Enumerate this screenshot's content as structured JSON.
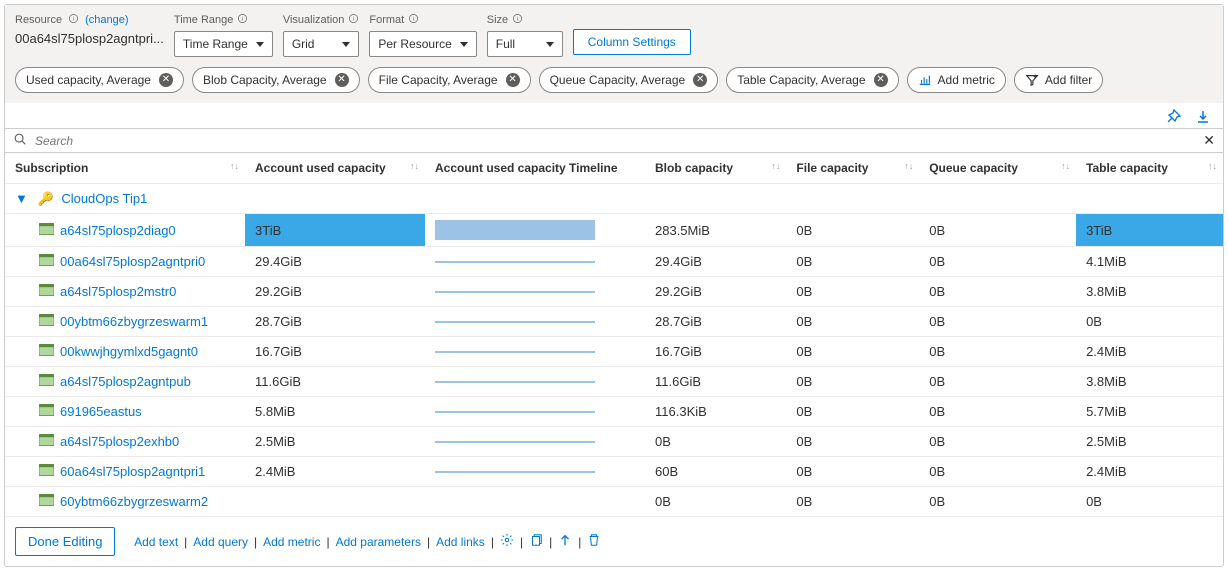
{
  "toolbar": {
    "resource_label": "Resource",
    "change_link": "(change)",
    "resource_name": "00a64sl75plosp2agntpri...",
    "time_range_label": "Time Range",
    "time_range_value": "Time Range",
    "visualization_label": "Visualization",
    "visualization_value": "Grid",
    "format_label": "Format",
    "format_value": "Per Resource",
    "size_label": "Size",
    "size_value": "Full",
    "column_settings": "Column Settings"
  },
  "metrics": [
    "Used capacity, Average",
    "Blob Capacity, Average",
    "File Capacity, Average",
    "Queue Capacity, Average",
    "Table Capacity, Average"
  ],
  "add_metric": "Add metric",
  "add_filter": "Add filter",
  "search_placeholder": "Search",
  "columns": {
    "subscription": "Subscription",
    "used": "Account used capacity",
    "timeline": "Account used capacity Timeline",
    "blob": "Blob capacity",
    "file": "File capacity",
    "queue": "Queue capacity",
    "table": "Table capacity"
  },
  "group_name": "CloudOps Tip1",
  "rows": [
    {
      "name": "a64sl75plosp2diag0",
      "used": "3TiB",
      "used_pct": 100,
      "tl": "big",
      "blob": "283.5MiB",
      "file": "0B",
      "queue": "0B",
      "table": "3TiB",
      "table_hl": true
    },
    {
      "name": "00a64sl75plosp2agntpri0",
      "used": "29.4GiB",
      "used_pct": 0,
      "tl": "small",
      "blob": "29.4GiB",
      "file": "0B",
      "queue": "0B",
      "table": "4.1MiB"
    },
    {
      "name": "a64sl75plosp2mstr0",
      "used": "29.2GiB",
      "used_pct": 0,
      "tl": "small",
      "blob": "29.2GiB",
      "file": "0B",
      "queue": "0B",
      "table": "3.8MiB"
    },
    {
      "name": "00ybtm66zbygrzeswarm1",
      "used": "28.7GiB",
      "used_pct": 0,
      "tl": "small",
      "blob": "28.7GiB",
      "file": "0B",
      "queue": "0B",
      "table": "0B"
    },
    {
      "name": "00kwwjhgymlxd5gagnt0",
      "used": "16.7GiB",
      "used_pct": 0,
      "tl": "small",
      "blob": "16.7GiB",
      "file": "0B",
      "queue": "0B",
      "table": "2.4MiB"
    },
    {
      "name": "a64sl75plosp2agntpub",
      "used": "11.6GiB",
      "used_pct": 0,
      "tl": "small",
      "blob": "11.6GiB",
      "file": "0B",
      "queue": "0B",
      "table": "3.8MiB"
    },
    {
      "name": "691965eastus",
      "used": "5.8MiB",
      "used_pct": 0,
      "tl": "small",
      "blob": "116.3KiB",
      "file": "0B",
      "queue": "0B",
      "table": "5.7MiB"
    },
    {
      "name": "a64sl75plosp2exhb0",
      "used": "2.5MiB",
      "used_pct": 0,
      "tl": "small",
      "blob": "0B",
      "file": "0B",
      "queue": "0B",
      "table": "2.5MiB"
    },
    {
      "name": "60a64sl75plosp2agntpri1",
      "used": "2.4MiB",
      "used_pct": 0,
      "tl": "small",
      "blob": "60B",
      "file": "0B",
      "queue": "0B",
      "table": "2.4MiB"
    },
    {
      "name": "60ybtm66zbygrzeswarm2",
      "used": "",
      "used_pct": 0,
      "tl": "none",
      "blob": "0B",
      "file": "0B",
      "queue": "0B",
      "table": "0B"
    }
  ],
  "footer": {
    "done": "Done Editing",
    "add_text": "Add text",
    "add_query": "Add query",
    "add_metric": "Add metric",
    "add_parameters": "Add parameters",
    "add_links": "Add links"
  }
}
